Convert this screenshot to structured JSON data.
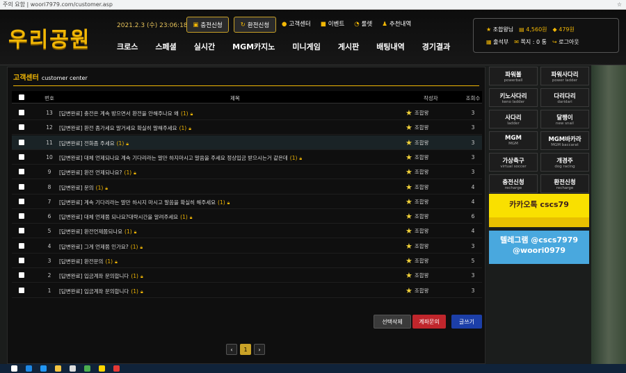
{
  "browser": {
    "security": "주의 요함",
    "url": "woori7979.com/customer.asp"
  },
  "header": {
    "logo": "우리공원",
    "datetime": "2021.2.3 (수) 23:06:18",
    "charge_btn": "충전신청",
    "exchange_btn": "환전신청",
    "top_links": [
      {
        "label": "고객센터",
        "icon": "person-icon"
      },
      {
        "label": "이벤트",
        "icon": "gift-icon"
      },
      {
        "label": "룰렛",
        "icon": "roulette-icon"
      },
      {
        "label": "추천내역",
        "icon": "user-add-icon"
      }
    ],
    "nav": [
      "크로스",
      "스페셜",
      "실시간",
      "MGM카지노",
      "미니게임",
      "게시판",
      "배팅내역",
      "경기결과"
    ]
  },
  "user": {
    "name": "조합왕님",
    "money": "4,560원",
    "point": "479원",
    "attendance": "출석부",
    "memo": "쪽지 : 0 통",
    "logout": "로그아웃"
  },
  "board": {
    "title": "고객센터",
    "subtitle": "customer center",
    "columns": {
      "no": "번호",
      "title": "제목",
      "writer": "작성자",
      "views": "조회수"
    },
    "rows": [
      {
        "no": "13",
        "title": "[답변완료] 충전은 계속 방으면서 환전을 안해주나요 왜",
        "count": "(1)",
        "writer": "조합왕",
        "views": "3"
      },
      {
        "no": "12",
        "title": "[답변완료] 환전 좀가세요 말거세요 확실히 말해주세요",
        "count": "(1)",
        "writer": "조합왕",
        "views": "3"
      },
      {
        "no": "11",
        "title": "[답변완료] 전화좀 주세요",
        "count": "(1)",
        "writer": "조합왕",
        "views": "3"
      },
      {
        "no": "10",
        "title": "[답변완료] 대체 언제되나요 계속 기다리라는 말만 하지마시고 말씀을 주세요 정상입금 받으시는거 같은데",
        "count": "(1)",
        "writer": "조합왕",
        "views": "3"
      },
      {
        "no": "9",
        "title": "[답변완료] 환전 언제되나요?",
        "count": "(1)",
        "writer": "조합왕",
        "views": "3"
      },
      {
        "no": "8",
        "title": "[답변완료] 문의",
        "count": "(1)",
        "writer": "조합왕",
        "views": "4"
      },
      {
        "no": "7",
        "title": "[답변완료] 계속 기다리라는 말만 하시지 마시고 말씀을 확실히 해주세요",
        "count": "(1)",
        "writer": "조합왕",
        "views": "4"
      },
      {
        "no": "6",
        "title": "[답변완료] 대체 언제쯤 되나요?대략시간을 알려주세요",
        "count": "(1)",
        "writer": "조합왕",
        "views": "6"
      },
      {
        "no": "5",
        "title": "[답변완료] 환전언제쯤되나요",
        "count": "(1)",
        "writer": "조합왕",
        "views": "4"
      },
      {
        "no": "4",
        "title": "[답변완료] 그게 언제쯤 인가요?",
        "count": "(1)",
        "writer": "조합왕",
        "views": "3"
      },
      {
        "no": "3",
        "title": "[답변완료] 환전문의",
        "count": "(1)",
        "writer": "조합왕",
        "views": "5"
      },
      {
        "no": "2",
        "title": "[답변완료] 입금계좌 문의합니다",
        "count": "(1)",
        "writer": "조합왕",
        "views": "3"
      },
      {
        "no": "1",
        "title": "[답변완료] 입금계좌 문의합니다",
        "count": "(1)",
        "writer": "조합왕",
        "views": "3"
      }
    ],
    "actions": {
      "delete": "선택삭제",
      "account": "계좌문의",
      "write": "글쓰기"
    },
    "page": "1",
    "colors": {
      "delete": "#3a3a3a",
      "account": "#c0262c",
      "write": "#1c3fa8"
    }
  },
  "side": {
    "games": [
      {
        "name": "파워볼",
        "sub": "powerball"
      },
      {
        "name": "파워사다리",
        "sub": "power ladder"
      },
      {
        "name": "키노사다리",
        "sub": "keno ladder"
      },
      {
        "name": "다리다리",
        "sub": "daridari"
      },
      {
        "name": "사다리",
        "sub": "ladder"
      },
      {
        "name": "달팽이",
        "sub": "new snail"
      },
      {
        "name": "MGM",
        "sub": "MGM"
      },
      {
        "name": "MGM바카라",
        "sub": "MGM baccarat"
      },
      {
        "name": "가상축구",
        "sub": "virtual soccer"
      },
      {
        "name": "개경주",
        "sub": "dog racing"
      },
      {
        "name": "충전신청",
        "sub": "recharge"
      },
      {
        "name": "환전신청",
        "sub": "recharge"
      }
    ],
    "kakao": "카카오톡 cscs79",
    "telegram1": "텔레그램 @cscs7979",
    "telegram2": "@woori0979"
  }
}
